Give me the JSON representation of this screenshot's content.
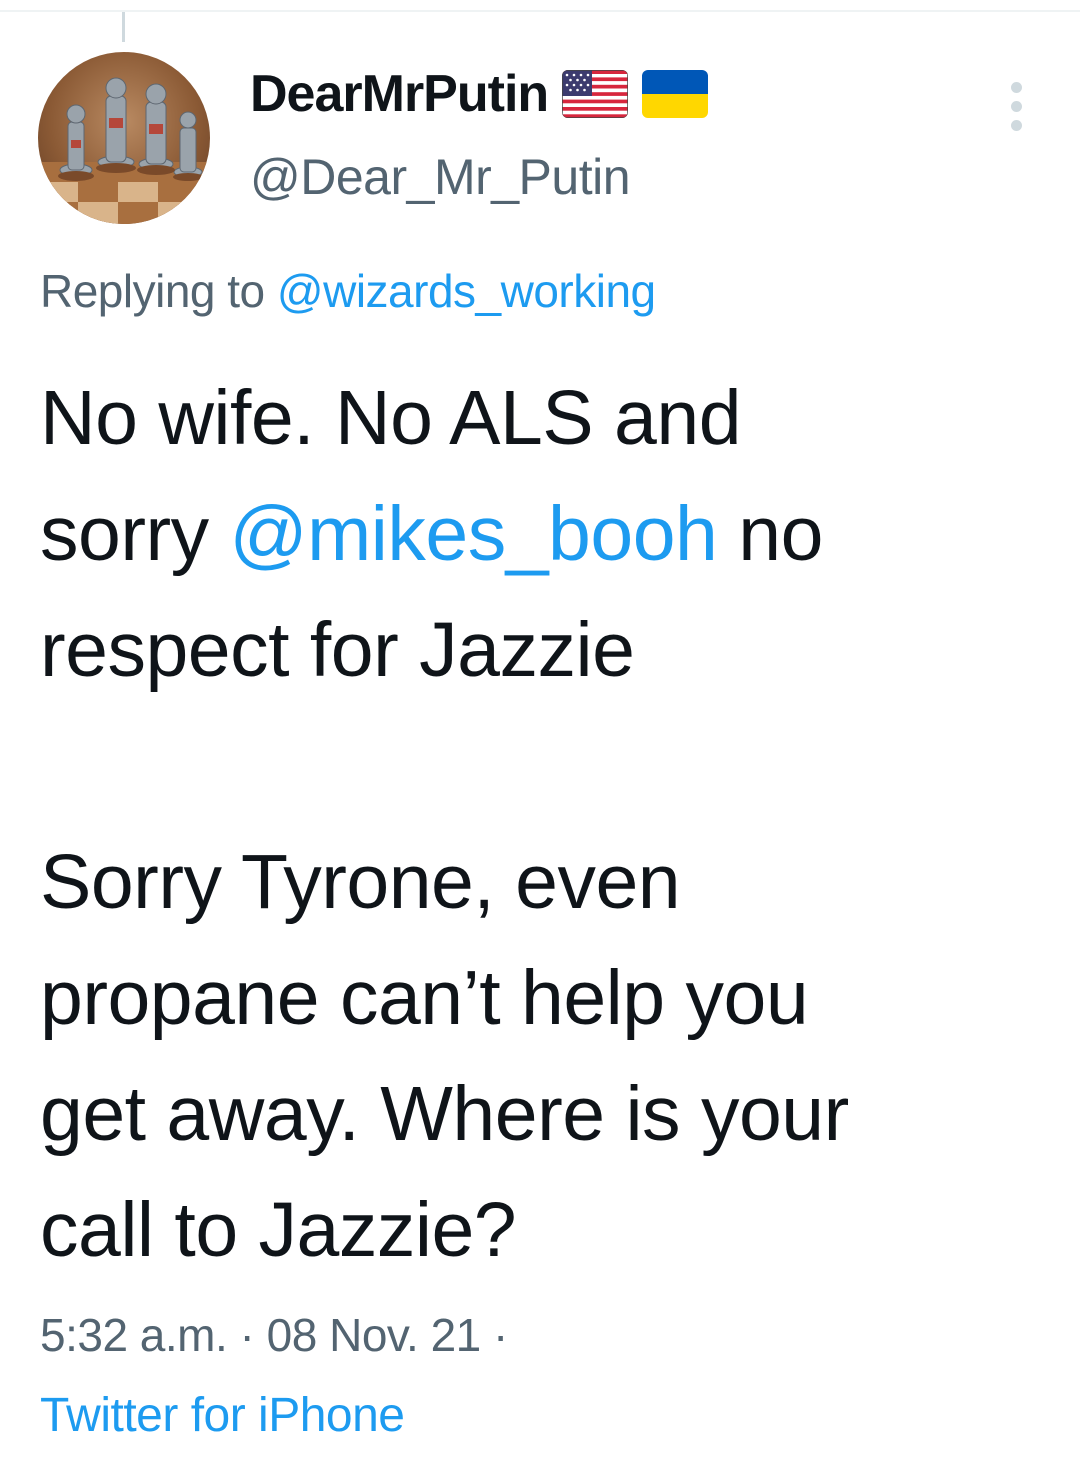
{
  "author": {
    "display_name": "DearMrPutin",
    "handle": "@Dear_Mr_Putin",
    "avatar_icon": "chess-pieces-avatar",
    "badges": [
      "us-flag-icon",
      "ukraine-flag-icon"
    ]
  },
  "reply": {
    "prefix": "Replying to",
    "mention": "@wizards_working"
  },
  "tweet": {
    "line1": "No wife. No ALS and",
    "line2_pre": "sorry ",
    "line2_mention": "@mikes_booh",
    "line2_post": " no",
    "line3": "respect for Jazzie",
    "line4": "Sorry Tyrone, even",
    "line5": "propane can’t help you",
    "line6": "get away. Where is your",
    "line7": "call to Jazzie?"
  },
  "meta": {
    "time": "5:32 a.m.",
    "date": "08 Nov. 21",
    "sep": " · ",
    "trail": " ·",
    "source": "Twitter for iPhone"
  },
  "colors": {
    "link": "#1d9bf0",
    "secondary_text": "#536471",
    "primary_text": "#0f1419"
  }
}
